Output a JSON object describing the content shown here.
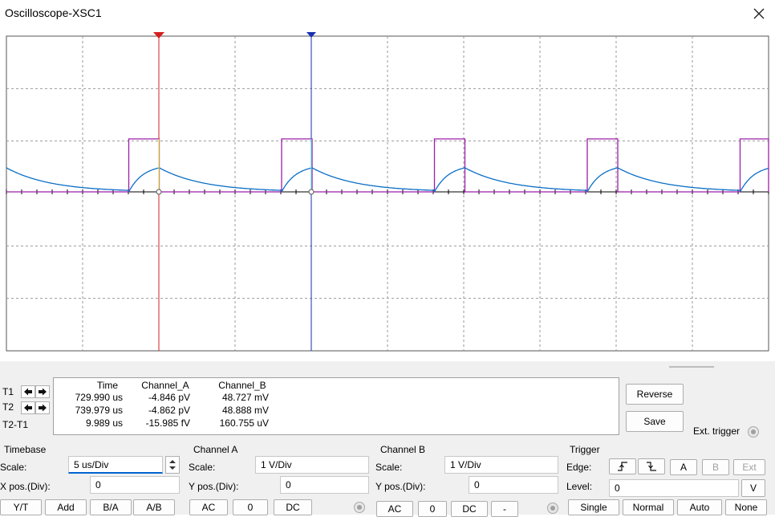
{
  "window": {
    "title": "Oscilloscope-XSC1"
  },
  "readout": {
    "headers": [
      "Time",
      "Channel_A",
      "Channel_B"
    ],
    "rows": [
      {
        "label": "T1",
        "time": "729.990 us",
        "a": "-4.846 pV",
        "b": "48.727 mV"
      },
      {
        "label": "T2",
        "time": "739.979 us",
        "a": "-4.862 pV",
        "b": "48.888 mV"
      },
      {
        "label": "T2-T1",
        "time": "9.989 us",
        "a": "-15.985 fV",
        "b": "160.755 uV"
      }
    ]
  },
  "buttons": {
    "reverse": "Reverse",
    "save": "Save",
    "ext_trigger": "Ext. trigger"
  },
  "timebase": {
    "title": "Timebase",
    "scale_label": "Scale:",
    "scale": "5 us/Div",
    "xpos_label": "X pos.(Div):",
    "xpos": "0",
    "modes": [
      "Y/T",
      "Add",
      "B/A",
      "A/B"
    ]
  },
  "channel_a": {
    "title": "Channel A",
    "scale_label": "Scale:",
    "scale": "1  V/Div",
    "ypos_label": "Y pos.(Div):",
    "ypos": "0",
    "coupling": [
      "AC",
      "0",
      "DC"
    ]
  },
  "channel_b": {
    "title": "Channel B",
    "scale_label": "Scale:",
    "scale": "1  V/Div",
    "ypos_label": "Y pos.(Div):",
    "ypos": "0",
    "coupling": [
      "AC",
      "0",
      "DC",
      "-"
    ]
  },
  "trigger": {
    "title": "Trigger",
    "edge_label": "Edge:",
    "level_label": "Level:",
    "level": "0",
    "level_unit": "V",
    "sources": [
      "A",
      "B",
      "Ext"
    ],
    "modes": [
      "Single",
      "Normal",
      "Auto",
      "None"
    ]
  },
  "colors": {
    "channel_a": "#0b6fc7",
    "channel_b": "#9b1fa8",
    "cursor1": "#d42020",
    "cursor2": "#1a2fb0",
    "grid": "#9a9a9a"
  },
  "icons": {
    "close": "close-icon",
    "arrow_left": "arrow-left-icon",
    "arrow_right": "arrow-right-icon",
    "rising_edge": "rising-edge-icon",
    "falling_edge": "falling-edge-icon"
  }
}
